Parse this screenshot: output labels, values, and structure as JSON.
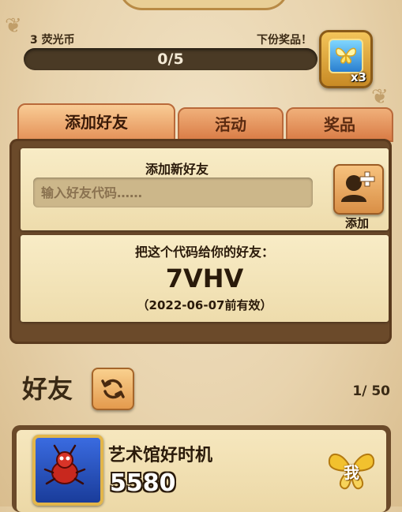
{
  "reward": {
    "currency_label": "3 荧光币",
    "next_reward_label": "下份奖品！",
    "progress_text": "0/5",
    "progress_fraction": 0,
    "reward_count": "x3",
    "reward_icon": "butterfly-icon"
  },
  "tabs": [
    {
      "label": "添加好友",
      "active": true
    },
    {
      "label": "活动",
      "active": false
    },
    {
      "label": "奖品",
      "active": false
    }
  ],
  "add_friend": {
    "title": "添加新好友",
    "placeholder": "输入好友代码……",
    "add_label": "添加",
    "add_icon": "add-user-icon"
  },
  "share": {
    "title": "把这个代码给你的好友：",
    "code": "7VHV",
    "expiry": "（2022-06-07前有效）"
  },
  "friends": {
    "title": "好友",
    "count": "1/ 50",
    "refresh_icon": "refresh-icon",
    "list": [
      {
        "name": "艺术馆好时机",
        "score": "5580",
        "badge": "我"
      }
    ]
  },
  "colors": {
    "background": "#e8d3ad",
    "tab_active": "#e38f56",
    "panel": "#6b4a2a",
    "progress_track": "#4a3a25",
    "badge_gold": "#f2c12e"
  }
}
